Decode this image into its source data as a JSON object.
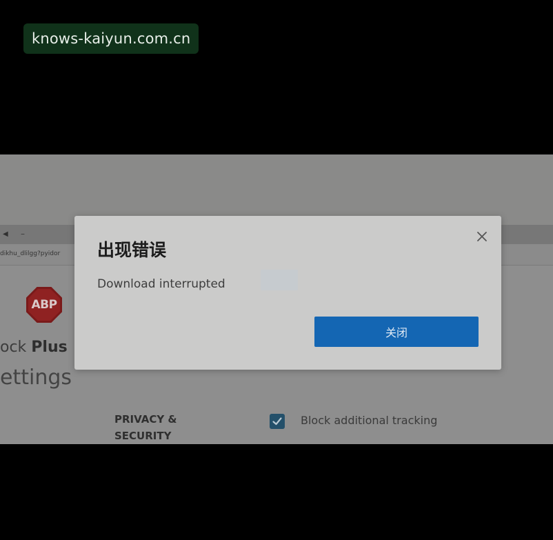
{
  "watermark": {
    "text": "knows-kaiyun.com.cn"
  },
  "background_page": {
    "url": "dikhu_dlilgg?pyidor",
    "logo_text": "ABP",
    "brand_prefix": "ock ",
    "brand_bold": "Plus",
    "settings_heading": "ettings",
    "section_title": "PRIVACY & SECURITY",
    "checkbox_label": "Block additional tracking",
    "checkbox_checked": true
  },
  "dialog": {
    "title": "出现错误",
    "message": "Download interrupted",
    "button_label": "关闭",
    "button_color": "#1466b3"
  },
  "colors": {
    "overlay_frame": "#8a8a89",
    "dialog_bg": "#cbcbca",
    "watermark_bg": "#10321a"
  }
}
